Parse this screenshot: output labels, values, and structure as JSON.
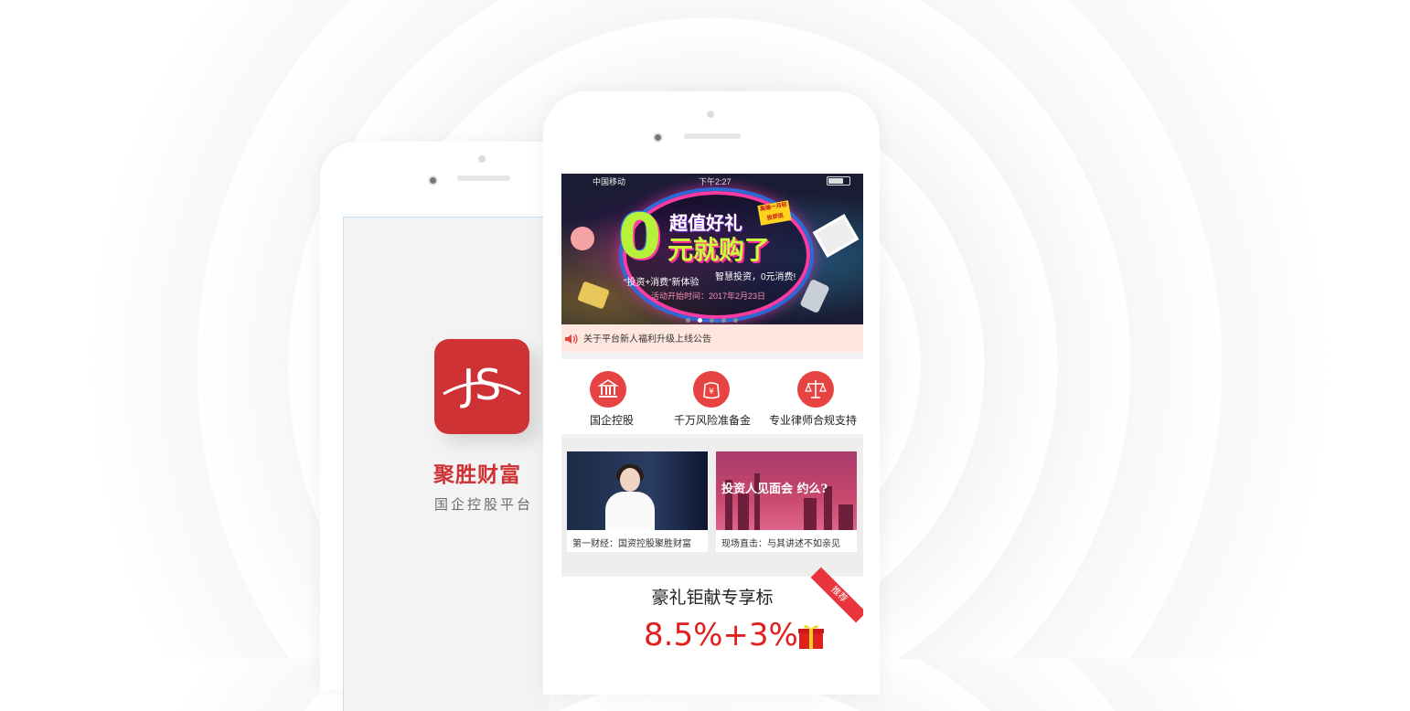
{
  "back_phone": {
    "app_name": "聚胜财富",
    "slogan": "国企控股平台",
    "logo_text": "JS"
  },
  "status_bar": {
    "carrier": "中国移动",
    "time": "下午2:27"
  },
  "banner": {
    "big_digit": "0",
    "headline_1": "超值好礼",
    "headline_2": "元就购了",
    "tag": "高端一月标 投即送",
    "sub_1": "“投资+消费”新体验",
    "sub_2": "智慧投资，0元消费!",
    "date": "活动开始时间：2017年2月23日",
    "slides": 5,
    "active_slide": 2
  },
  "notice": {
    "text": "关于平台新人福利升级上线公告"
  },
  "features": [
    {
      "label": "国企控股",
      "icon": "bank-icon"
    },
    {
      "label": "千万风险准备金",
      "icon": "money-bag-icon"
    },
    {
      "label": "专业律师合规支持",
      "icon": "scale-icon"
    }
  ],
  "news": [
    {
      "caption": "第一财经：国资控股聚胜财富"
    },
    {
      "caption": "现场直击：与其讲述不如亲见",
      "image_text": "投资人见面会 约么?"
    }
  ],
  "product": {
    "title": "豪礼钜献专享标",
    "rate": "8.5%+3%",
    "badge": "推荐"
  },
  "colors": {
    "brand_red": "#cf3234",
    "accent_red": "#e0201f",
    "notice_bg": "#ffe7df"
  }
}
